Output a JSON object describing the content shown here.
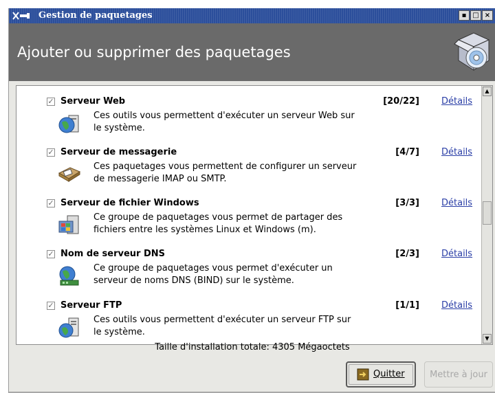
{
  "window": {
    "title": "Gestion de paquetages",
    "title_icon": "network-plug-icon",
    "controls": [
      "minimize",
      "maximize",
      "close"
    ]
  },
  "header": {
    "title": "Ajouter ou supprimer des paquetages",
    "icon": "software-package-cd-icon"
  },
  "groups": [
    {
      "name": "Serveur Web",
      "checked": true,
      "count": "[20/22]",
      "details": "Détails",
      "icon": "web-server-globe-icon",
      "description_line1": "Ces outils vous permettent d'exécuter un serveur Web sur",
      "description_line2": "le système."
    },
    {
      "name": "Serveur de messagerie",
      "checked": true,
      "count": "[4/7]",
      "details": "Détails",
      "icon": "mail-server-icon",
      "description_line1": "Ces paquetages vous permettent de configurer un serveur",
      "description_line2": "de messagerie IMAP ou SMTP."
    },
    {
      "name": "Serveur de fichier Windows",
      "checked": true,
      "count": "[3/3]",
      "details": "Détails",
      "icon": "windows-file-server-icon",
      "description_line1": "Ce groupe de paquetages vous permet de partager des",
      "description_line2": "fichiers entre les systèmes Linux et Windows (m)."
    },
    {
      "name": "Nom de serveur DNS",
      "checked": true,
      "count": "[2/3]",
      "details": "Détails",
      "icon": "dns-server-globe-icon",
      "description_line1": "Ce groupe de paquetages vous permet d'exécuter un",
      "description_line2": "serveur de noms DNS (BIND) sur le système."
    },
    {
      "name": "Serveur FTP",
      "checked": true,
      "count": "[1/1]",
      "details": "Détails",
      "icon": "ftp-server-icon",
      "description_line1": "Ces outils vous permettent d'exécuter un serveur FTP sur",
      "description_line2": "le système."
    }
  ],
  "footer": {
    "total_label": "Taille d'installation totale: 4305 Mégaoctets",
    "quit_label": "Quitter",
    "update_label": "Mettre à jour"
  },
  "colors": {
    "titlebar": "#2b4e9b",
    "header": "#6a6a6a",
    "link": "#2a3ea6"
  }
}
